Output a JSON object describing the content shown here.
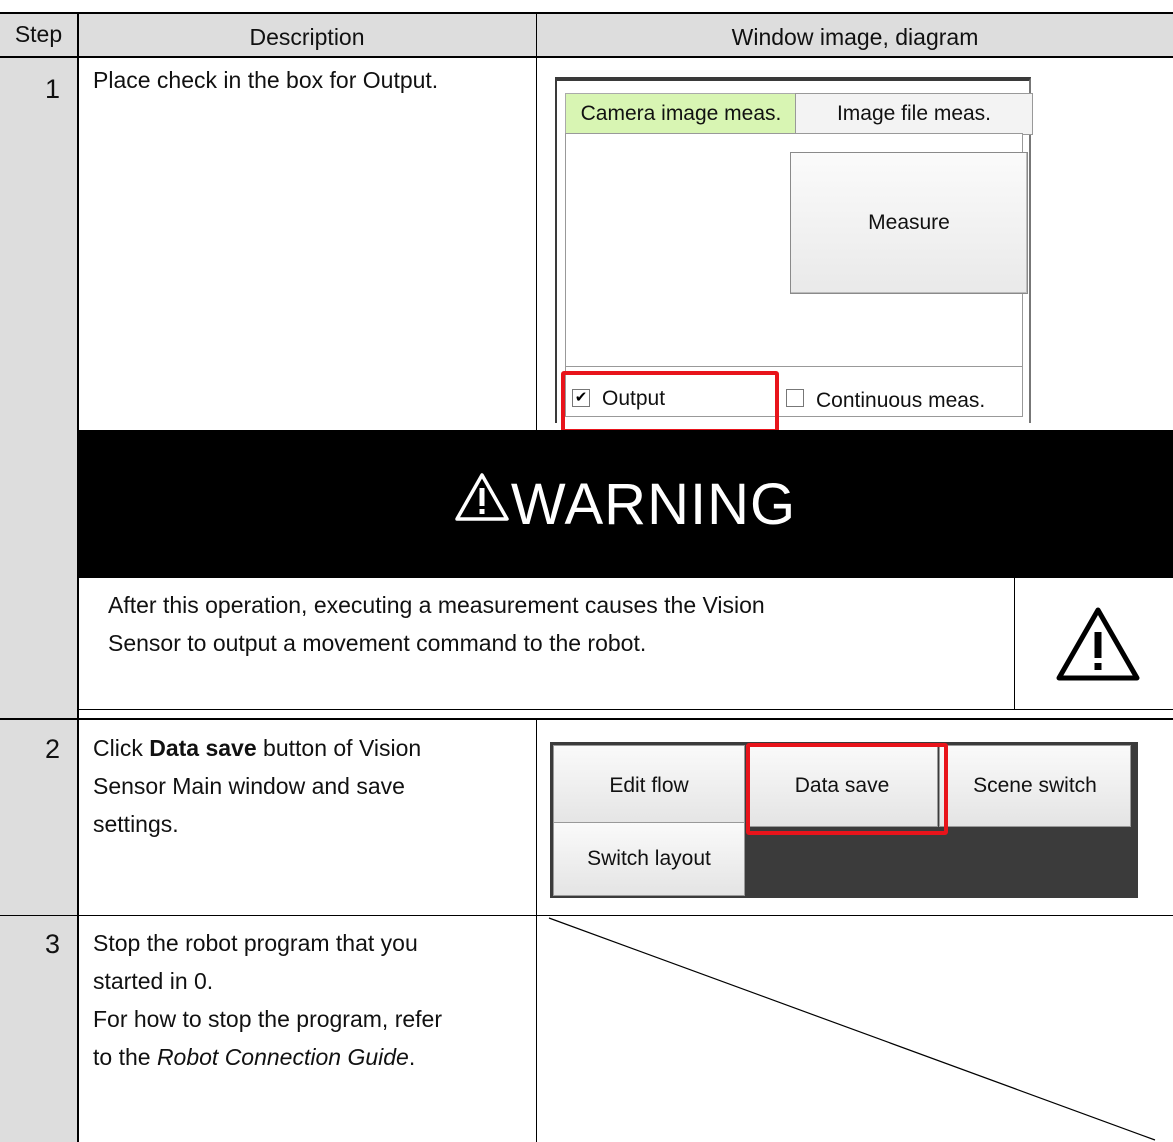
{
  "header": {
    "step": "Step",
    "description": "Description",
    "window_image": "Window image, diagram"
  },
  "steps": [
    {
      "number": "1",
      "description_lines": [
        "Place check in the box for Output."
      ],
      "screenshot": {
        "tabs": [
          "Camera image meas.",
          "Image file meas."
        ],
        "measure_button": "Measure",
        "checkboxes": [
          {
            "label": "Output",
            "checked": true
          },
          {
            "label": "Continuous meas.",
            "checked": false
          }
        ]
      }
    },
    {
      "number": "2",
      "description_line1_bold": "Data save",
      "description_line1_rest": " button of Vision",
      "description_line1_prefix": "Click ",
      "description_lines": [
        "Sensor Main window and save",
        "settings."
      ],
      "screenshot": {
        "buttons": [
          "Edit flow",
          "Data save",
          "Scene switch",
          "Switch layout"
        ]
      }
    },
    {
      "number": "3",
      "description_lines": [
        "Stop the robot program that you",
        "started in 0.",
        "For how to stop the program, refer"
      ],
      "description_last_prefix": "to the ",
      "description_last_italic": "Robot Connection Guide",
      "description_last_suffix": "."
    }
  ],
  "warning": {
    "title": "WARNING",
    "text_lines": [
      "After this operation, executing a measurement causes the Vision",
      "Sensor to output a movement command to the robot."
    ],
    "icon": "warning-triangle-icon"
  },
  "colors": {
    "highlight": "#e8141b",
    "active_tab": "#d8f5b3",
    "step_column": "#dddddd"
  }
}
